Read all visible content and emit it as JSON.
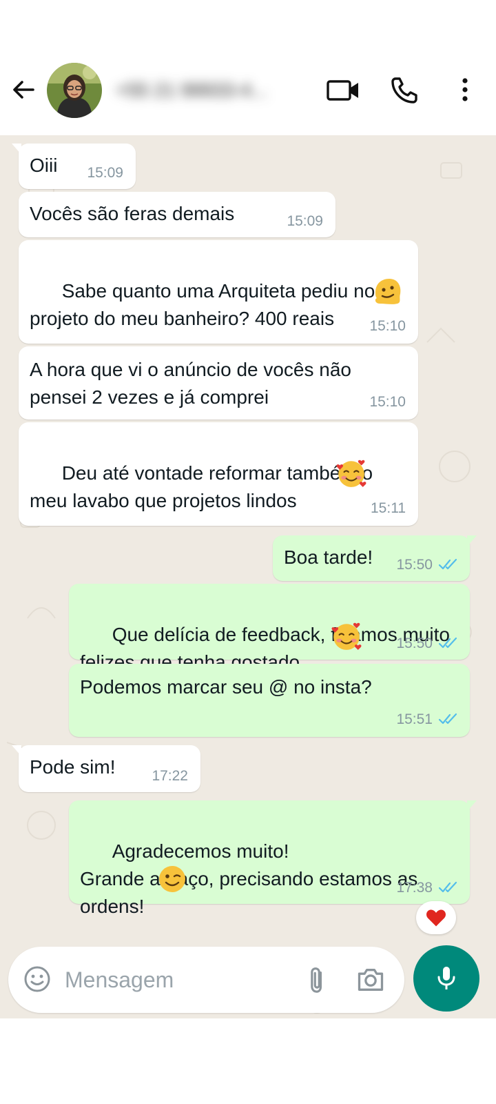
{
  "header": {
    "contact_name": "+55 21 99933-4...",
    "icons": [
      "back-arrow-icon",
      "video-call-icon",
      "voice-call-icon",
      "more-options-icon"
    ]
  },
  "messages": [
    {
      "dir": "in",
      "text": "Oiii",
      "time": "15:09"
    },
    {
      "dir": "in",
      "text": "Vocês são feras demais",
      "time": "15:09"
    },
    {
      "dir": "in",
      "text": "Sabe quanto uma Arquiteta pediu no\nprojeto do meu banheiro? 400 reais",
      "emoji": "melting-face-icon",
      "time": "15:10"
    },
    {
      "dir": "in",
      "text": "A hora que vi o anúncio de vocês não\npensei 2 vezes e já comprei",
      "time": "15:10"
    },
    {
      "dir": "in",
      "text": "Deu até vontade reformar também o\nmeu lavabo que projetos lindos",
      "emoji": "smiling-face-with-hearts-icon",
      "time": "15:11"
    },
    {
      "dir": "out",
      "text": "Boa tarde!",
      "time": "15:50",
      "status": "read"
    },
    {
      "dir": "out",
      "text": "Que delícia de feedback, ficamos muito\nfelizes que tenha gostado",
      "emoji": "smiling-face-with-hearts-icon",
      "time": "15:50",
      "status": "read"
    },
    {
      "dir": "out",
      "text": "Podemos marcar seu @ no insta?",
      "time": "15:51",
      "status": "read"
    },
    {
      "dir": "in",
      "text": "Pode sim!",
      "time": "17:22"
    },
    {
      "dir": "out",
      "text": "Agradecemos muito!\nGrande abraço, precisando estamos as\nordens!",
      "emoji": "winking-face-icon",
      "time": "17:38",
      "status": "read"
    }
  ],
  "reaction": {
    "emoji": "red-heart-icon"
  },
  "composer": {
    "placeholder": "Mensagem"
  },
  "colors": {
    "chat_bg": "#efeae2",
    "incoming_bubble": "#ffffff",
    "outgoing_bubble": "#d9fdd3",
    "read_ticks": "#53bdeb",
    "mic_button": "#00897b",
    "timestamp": "#8696a0"
  }
}
